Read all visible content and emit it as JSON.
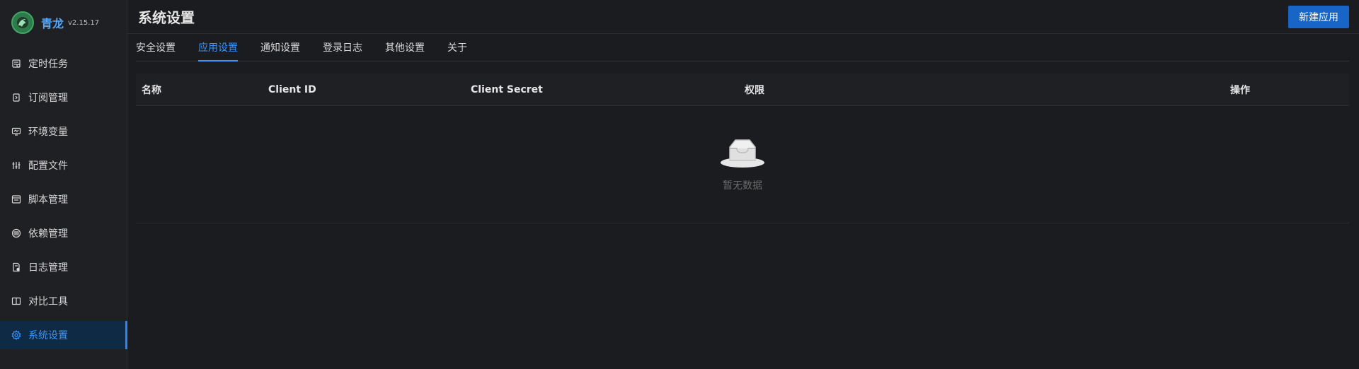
{
  "brand": {
    "name": "青龙",
    "version": "v2.15.17"
  },
  "sidebar": {
    "items": [
      {
        "label": "定时任务",
        "icon": "calendar-icon"
      },
      {
        "label": "订阅管理",
        "icon": "subscription-icon"
      },
      {
        "label": "环境变量",
        "icon": "monitor-icon"
      },
      {
        "label": "配置文件",
        "icon": "sliders-icon"
      },
      {
        "label": "脚本管理",
        "icon": "code-window-icon"
      },
      {
        "label": "依赖管理",
        "icon": "layers-icon"
      },
      {
        "label": "日志管理",
        "icon": "log-file-icon"
      },
      {
        "label": "对比工具",
        "icon": "diff-icon"
      },
      {
        "label": "系统设置",
        "icon": "gear-icon",
        "active": true
      }
    ]
  },
  "header": {
    "title": "系统设置",
    "primary_button": "新建应用"
  },
  "tabs": [
    {
      "label": "安全设置"
    },
    {
      "label": "应用设置",
      "active": true
    },
    {
      "label": "通知设置"
    },
    {
      "label": "登录日志"
    },
    {
      "label": "其他设置"
    },
    {
      "label": "关于"
    }
  ],
  "table": {
    "columns": [
      "名称",
      "Client ID",
      "Client Secret",
      "权限",
      "操作"
    ],
    "rows": [],
    "empty_text": "暂无数据"
  },
  "colors": {
    "accent": "#3b95ff",
    "primary_button": "#1765c7",
    "background": "#1b1c1f",
    "sidebar_background": "#1f2023",
    "active_item_background": "#0f2a44"
  }
}
